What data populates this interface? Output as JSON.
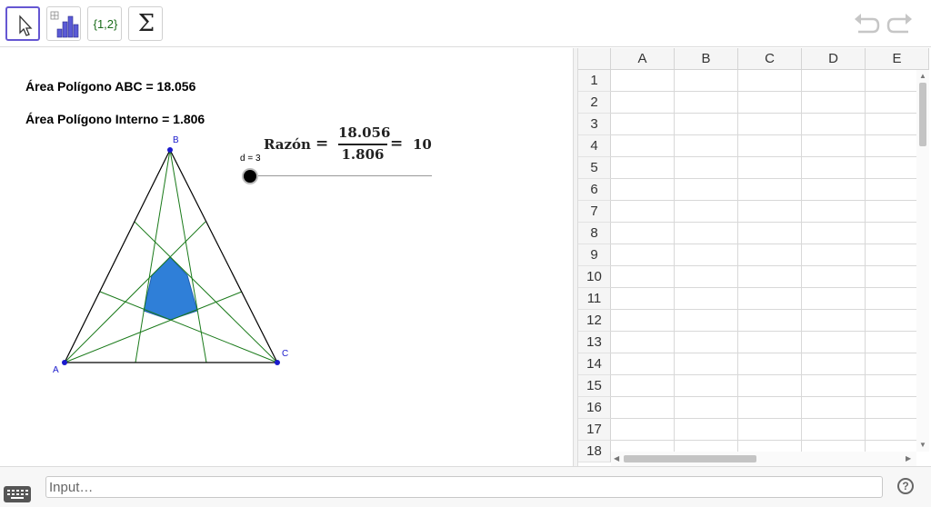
{
  "toolbar": {
    "list_label": "{1,2}",
    "sigma_label": "Σ"
  },
  "graphics": {
    "area_abc": "Área Polígono ABC = 18.056",
    "area_interno": "Área Polígono Interno = 1.806",
    "razon": {
      "label": "Razón",
      "equals": "=",
      "numerator": "18.056",
      "denominator": "1.806",
      "result": "10"
    },
    "slider_label": "d = 3",
    "points": {
      "A": "A",
      "B": "B",
      "C": "C"
    },
    "colors": {
      "triangle": "#000000",
      "cevians": "#1a7a1a",
      "inner_polygon": "#2f7fd8",
      "points": "#1a1acc"
    }
  },
  "spreadsheet": {
    "columns": [
      "A",
      "B",
      "C",
      "D",
      "E"
    ],
    "rows": [
      "1",
      "2",
      "3",
      "4",
      "5",
      "6",
      "7",
      "8",
      "9",
      "10",
      "11",
      "12",
      "13",
      "14",
      "15",
      "16",
      "17",
      "18"
    ]
  },
  "input_bar": {
    "placeholder": "Input…",
    "help_label": "?"
  }
}
